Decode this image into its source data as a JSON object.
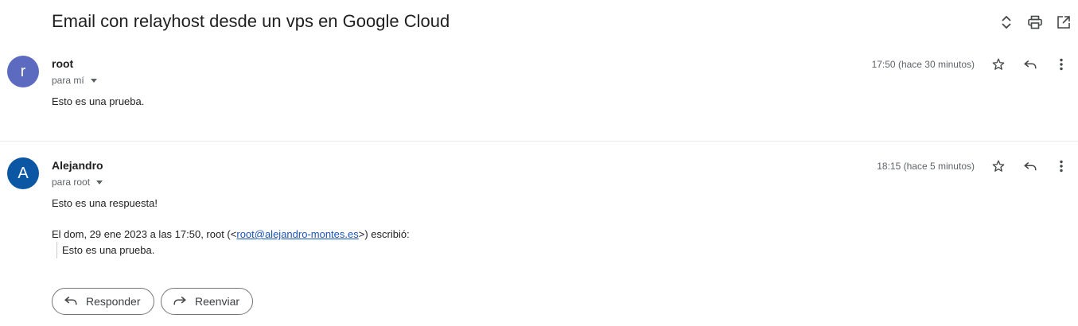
{
  "subject": "Email con relayhost desde un vps en Google Cloud",
  "messages": [
    {
      "avatar_letter": "r",
      "avatar_color": "#5c6bc0",
      "sender": "root",
      "to": "para mí",
      "time": "17:50 (hace 30 minutos)",
      "body": "Esto es una prueba."
    },
    {
      "avatar_letter": "A",
      "avatar_color": "#0b57a3",
      "sender": "Alejandro",
      "to": "para root",
      "time": "18:15 (hace 5 minutos)",
      "body": "Esto es una respuesta!",
      "quote_prefix": "El dom, 29 ene 2023 a las 17:50, root (<",
      "quote_email": "root@alejandro-montes.es",
      "quote_suffix": ">) escribió:",
      "quoted_text": "Esto es una prueba."
    }
  ],
  "buttons": {
    "reply": "Responder",
    "forward": "Reenviar"
  },
  "icons": [
    "expand-collapse-icon",
    "print-icon",
    "open-in-new-window-icon",
    "star-icon",
    "reply-icon",
    "more-vert-icon"
  ]
}
